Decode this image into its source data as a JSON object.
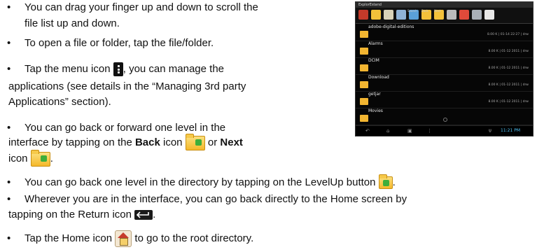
{
  "bullet_symbol": "•",
  "bullets": {
    "b1": {
      "l1": "You can drag your finger up and down to scroll the",
      "l2": "file list up and down."
    },
    "b2": {
      "l1": "To open a file or folder, tap the file/folder."
    },
    "b3": {
      "l1a": "Tap the menu icon",
      "l1b": ", you can manage the",
      "l2": "applications (see details in the “Managing 3rd party",
      "l3": "Applications” section)."
    },
    "b4": {
      "l1": "You can go back or forward one level in the",
      "l2a": "interface by tapping on the",
      "back_word": "Back",
      "l2b": "icon",
      "l2c": "or",
      "next_word": "Next",
      "l3": "icon",
      "l3_end": "."
    },
    "b5": {
      "l1a": "You can go back one level in the directory by tapping on the LevelUp button",
      "l1_end": "."
    },
    "b6": {
      "l1": "Wherever you are in the interface, you can go back directly to the Home screen by",
      "l2a": "tapping on the Return icon",
      "l2_end": "."
    },
    "b7": {
      "l1a": "Tap the Home icon",
      "l1b": "to go to the root directory."
    }
  },
  "icons": [
    "menu-icon",
    "back-folder-icon",
    "next-folder-icon",
    "levelup-folder-icon",
    "return-icon",
    "home-icon"
  ],
  "screenshot": {
    "title": "ExplorEstand",
    "toolbar_labels": [
      "Search",
      "Back",
      "Next"
    ],
    "files": [
      {
        "name": "adobe-digital-editions",
        "meta": "8.00 K | 01-14 22:27 | drw"
      },
      {
        "name": "Alarms",
        "meta": "8.00 K | 01-12 2011 | drw"
      },
      {
        "name": "DCIM",
        "meta": "8.00 K | 01-12 2011 | drw"
      },
      {
        "name": "Download",
        "meta": "8.00 K | 01-12 2011 | drw"
      },
      {
        "name": "getjar",
        "meta": "8.00 K | 01-12 2011 | drw"
      },
      {
        "name": "Movies",
        "meta": ""
      }
    ],
    "time": "11:21 PM",
    "colors": {
      "folder": "#f2b531",
      "status": "#4fc3f7"
    }
  }
}
